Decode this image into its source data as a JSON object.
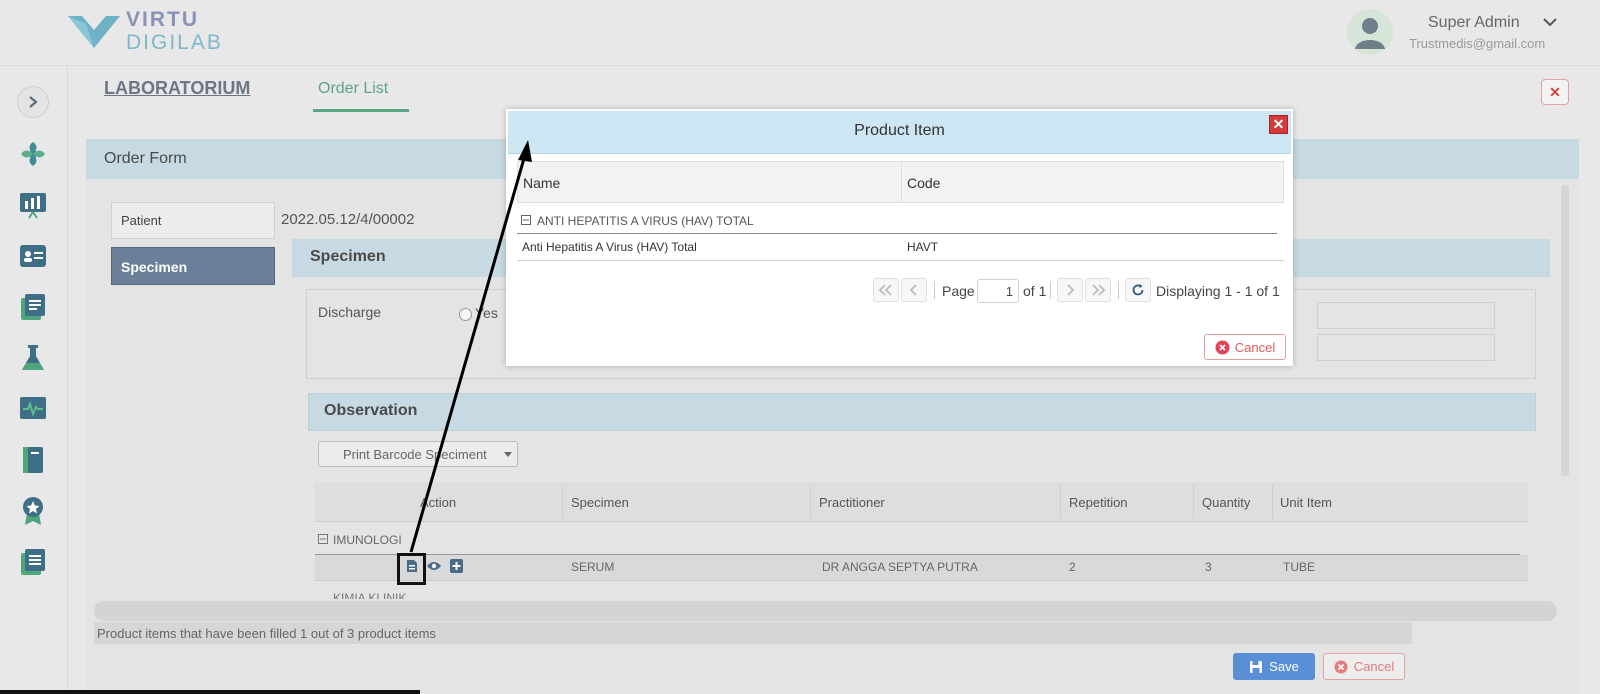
{
  "brand": {
    "line1": "VIRTU",
    "line2": "DIGILAB",
    "logo_icon": "v-logo-icon"
  },
  "user": {
    "name": "Super Admin",
    "email": "Trustmedis@gmail.com"
  },
  "nav": {
    "title": "LABORATORIUM",
    "active_tab": "Order List",
    "close_label": "✕"
  },
  "sidebar": {
    "icons": [
      "chevron-right-icon",
      "plus-logo-icon",
      "chart-icon",
      "id-card-icon",
      "document-icon",
      "flask-icon",
      "monitor-icon",
      "book-icon",
      "badge-icon",
      "notes-icon"
    ]
  },
  "order_form": {
    "title": "Order Form",
    "patient_label": "Patient",
    "patient_value": "2022.05.12/4/00002",
    "specimen_tab": "Specimen"
  },
  "specimen": {
    "title": "Specimen",
    "discharge_label": "Discharge",
    "yes_label": "Yes"
  },
  "observation": {
    "title": "Observation",
    "print_button": "Print Barcode Speciment",
    "columns": [
      "Action",
      "Specimen",
      "Practitioner",
      "Repetition",
      "Quantity",
      "Unit Item"
    ],
    "group1": "IMUNOLOGI",
    "row": {
      "specimen": "SERUM",
      "practitioner": "DR ANGGA SEPTYA PUTRA",
      "repetition": "2",
      "quantity": "3",
      "unit": "TUBE"
    },
    "group2": "KIMIA KLINIK"
  },
  "footer": {
    "status": "Product items that have been filled 1 out of 3 product items",
    "save": "Save",
    "cancel": "Cancel"
  },
  "modal": {
    "title": "Product Item",
    "columns": [
      "Name",
      "Code"
    ],
    "group": "ANTI HEPATITIS A VIRUS (HAV) TOTAL",
    "row": {
      "name": "Anti Hepatitis A Virus (HAV) Total",
      "code": "HAVT"
    },
    "pager": {
      "page_label": "Page",
      "page": "1",
      "of": "of 1",
      "display": "Displaying 1 - 1 of 1"
    },
    "cancel": "Cancel"
  },
  "colors": {
    "accent": "#5aa583",
    "header_blue": "#c7d9e2",
    "modal_head": "#cce7f3",
    "danger": "#d23b3b",
    "save": "#5a8fd6"
  }
}
